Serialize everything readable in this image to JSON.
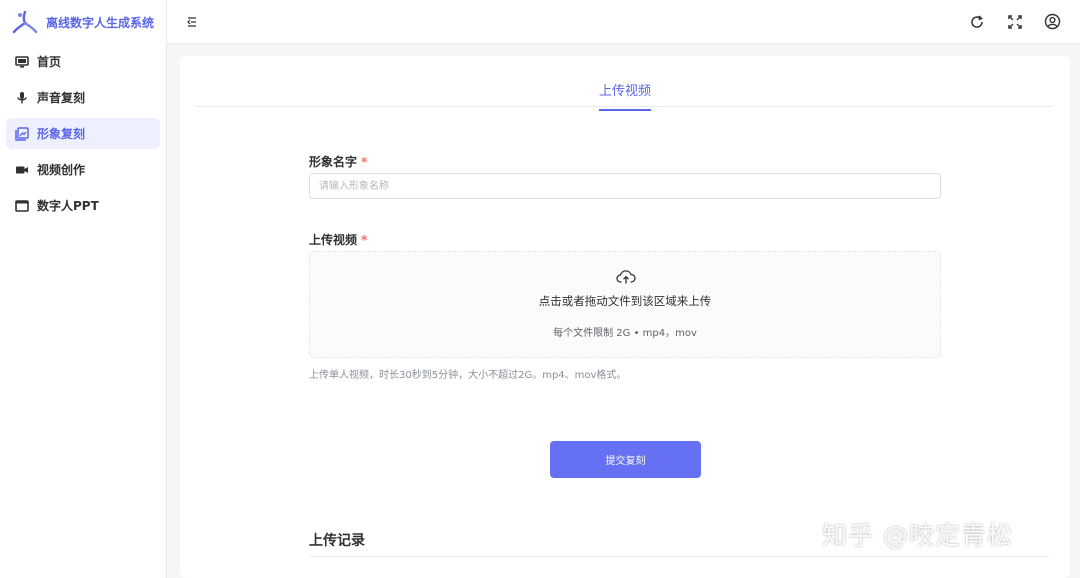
{
  "app": {
    "title": "离线数字人生成系统"
  },
  "sidebar": {
    "items": [
      {
        "label": "首页",
        "icon": "monitor-icon"
      },
      {
        "label": "声音复刻",
        "icon": "microphone-icon"
      },
      {
        "label": "形象复刻",
        "icon": "image-gallery-icon",
        "active": true
      },
      {
        "label": "视频创作",
        "icon": "video-camera-icon"
      },
      {
        "label": "数字人PPT",
        "icon": "presentation-icon"
      }
    ]
  },
  "header": {
    "icons": [
      "collapse-menu-icon",
      "refresh-icon",
      "fullscreen-icon",
      "user-icon"
    ]
  },
  "tabs": [
    {
      "label": "上传视频",
      "active": true
    }
  ],
  "form": {
    "name_label": "形象名字",
    "required_mark": "*",
    "name_placeholder": "请输入形象名称",
    "video_label": "上传视频",
    "upload_text": "点击或者拖动文件到该区域来上传",
    "upload_hint": "每个文件限制 2G • mp4，mov",
    "help_text": "上传单人视频，时长30秒到5分钟，大小不超过2G。mp4、mov格式。",
    "submit_label": "提交复刻"
  },
  "records": {
    "title": "上传记录"
  },
  "watermark": "知乎 @咬定青松",
  "colors": {
    "accent": "#5b66e8",
    "button": "#6570f2",
    "required": "#f56c6c",
    "active_bg": "#eef0ff"
  }
}
